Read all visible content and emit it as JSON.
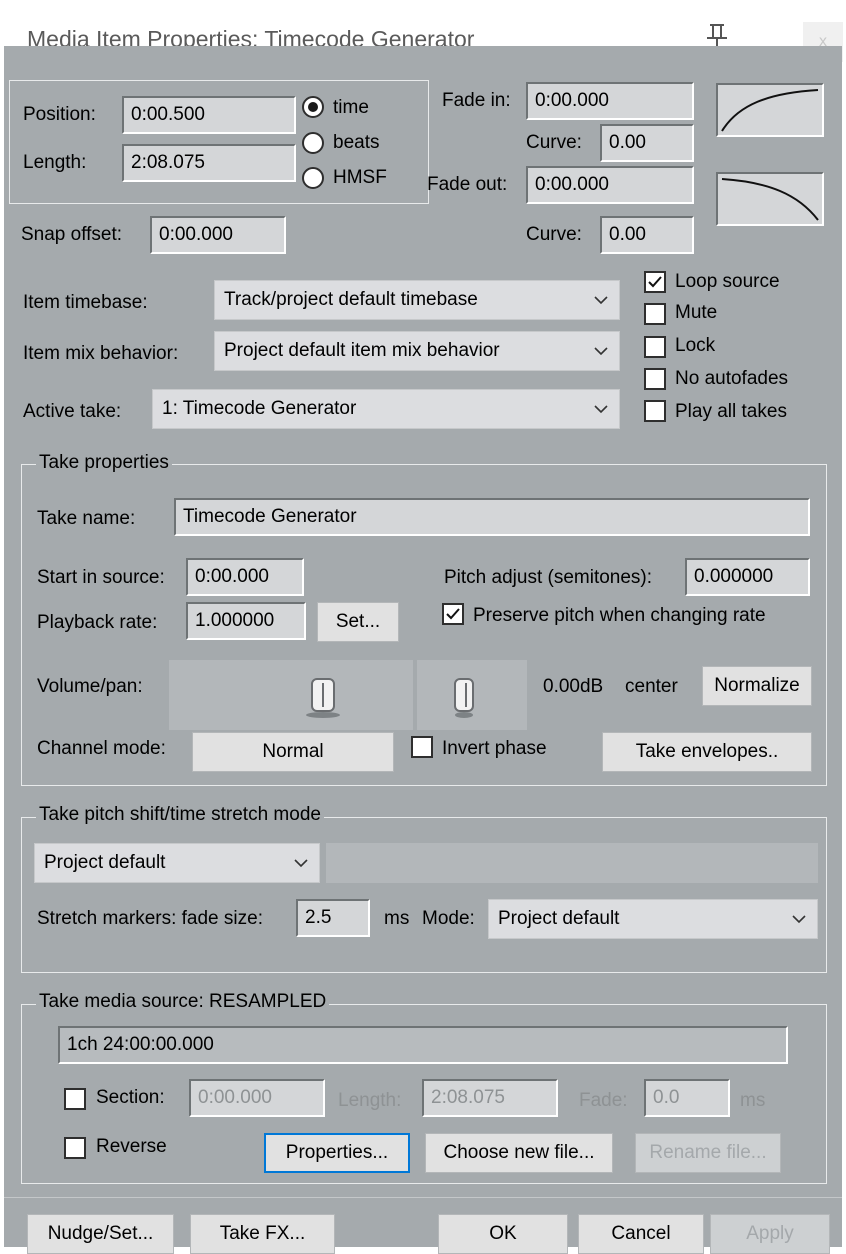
{
  "window": {
    "title": "Media Item Properties:  Timecode Generator",
    "close_label": "x",
    "pin_icon": "pin-icon"
  },
  "position": {
    "label": "Position:",
    "value": "0:00.500"
  },
  "length": {
    "label": "Length:",
    "value": "2:08.075"
  },
  "time_format": {
    "options": [
      "time",
      "beats",
      "HMSF"
    ],
    "selected": "time"
  },
  "fade_in": {
    "label": "Fade in:",
    "value": "0:00.000",
    "curve_label": "Curve:",
    "curve_value": "0.00"
  },
  "fade_out": {
    "label": "Fade out:",
    "value": "0:00.000",
    "curve_label": "Curve:",
    "curve_value": "0.00"
  },
  "snap_offset": {
    "label": "Snap offset:",
    "value": "0:00.000"
  },
  "item_timebase": {
    "label": "Item timebase:",
    "value": "Track/project default timebase"
  },
  "item_mix_behavior": {
    "label": "Item mix behavior:",
    "value": "Project default item mix behavior"
  },
  "active_take": {
    "label": "Active take:",
    "value": "1: Timecode Generator"
  },
  "checkboxes": [
    {
      "label": "Loop source",
      "checked": true
    },
    {
      "label": "Mute",
      "checked": false
    },
    {
      "label": "Lock",
      "checked": false
    },
    {
      "label": "No autofades",
      "checked": false
    },
    {
      "label": "Play all takes",
      "checked": false
    }
  ],
  "take_properties": {
    "group_title": "Take properties",
    "take_name_label": "Take name:",
    "take_name_value": "Timecode Generator",
    "start_in_source_label": "Start in source:",
    "start_in_source_value": "0:00.000",
    "pitch_adjust_label": "Pitch adjust (semitones):",
    "pitch_adjust_value": "0.000000",
    "playback_rate_label": "Playback rate:",
    "playback_rate_value": "1.000000",
    "set_button": "Set...",
    "preserve_pitch_label": "Preserve pitch when changing rate",
    "preserve_pitch_checked": true,
    "volume_pan_label": "Volume/pan:",
    "volume_readout": "0.00dB",
    "pan_readout": "center",
    "volume_level": 0.632,
    "pan_level": 0.43,
    "normalize_button": "Normalize",
    "channel_mode_label": "Channel mode:",
    "channel_mode_value": "Normal",
    "invert_phase_label": "Invert phase",
    "invert_phase_checked": false,
    "take_envelopes_button": "Take envelopes.."
  },
  "pitch_shift": {
    "group_title": "Take pitch shift/time stretch mode",
    "mode_value": "Project default",
    "submode_value": "",
    "stretch_label": "Stretch markers: fade size:",
    "fade_size_value": "2.5",
    "ms_label": "ms",
    "mode_label": "Mode:",
    "stretch_mode_value": "Project default"
  },
  "media_source": {
    "group_title": "Take media source:  RESAMPLED",
    "info": "1ch 24:00:00.000",
    "section_label": "Section:",
    "section_checked": false,
    "section_value": "0:00.000",
    "length_label": "Length:",
    "length_value": "2:08.075",
    "fade_label": "Fade:",
    "fade_value": "0.0",
    "ms_label": "ms",
    "reverse_label": "Reverse",
    "reverse_checked": false,
    "properties_button": "Properties...",
    "choose_file_button": "Choose new file...",
    "rename_file_button": "Rename file..."
  },
  "footer": {
    "nudge_button": "Nudge/Set...",
    "take_fx_button": "Take FX...",
    "ok_button": "OK",
    "cancel_button": "Cancel",
    "apply_button": "Apply"
  },
  "colors": {
    "dialog_bg": "#a5aaad",
    "field_bg": "#d4d6d8",
    "button_bg": "#e1e1e1",
    "focus": "#0078d7"
  }
}
